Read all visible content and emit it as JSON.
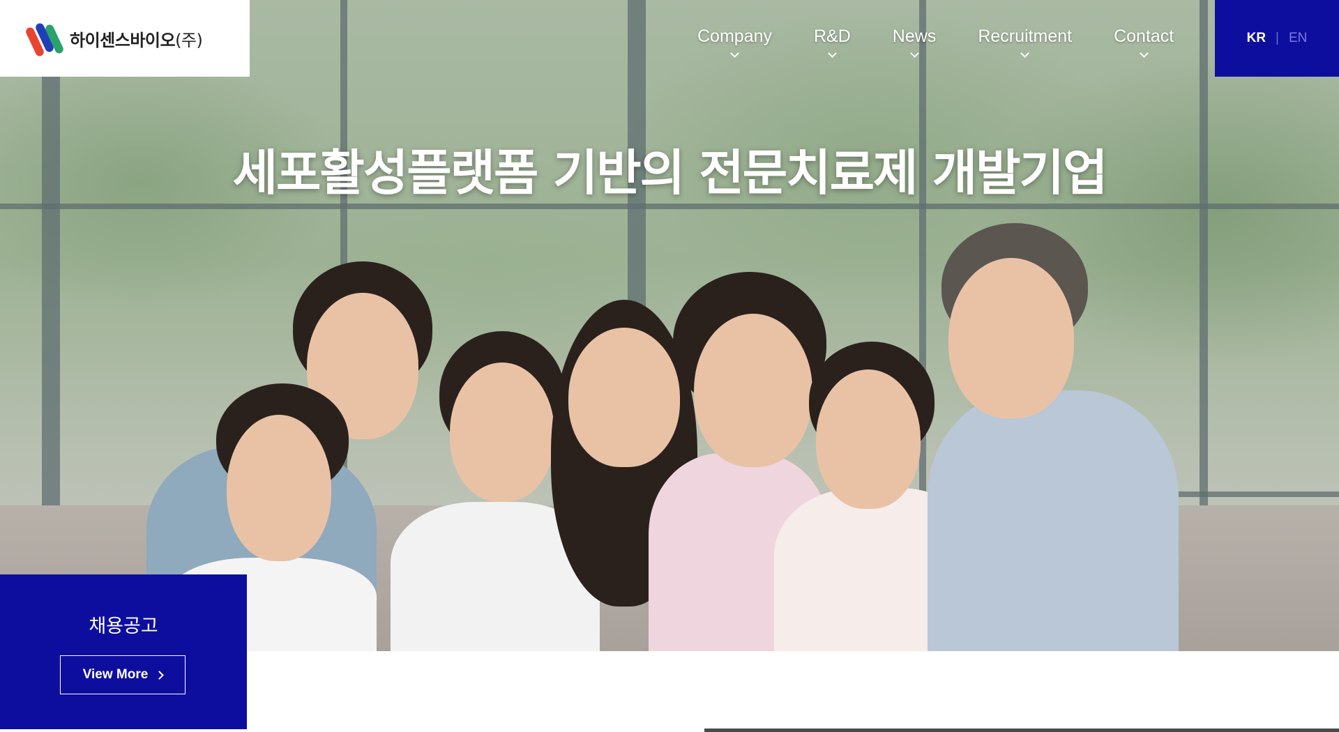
{
  "header": {
    "logo_text": "하이센스바이오",
    "logo_suffix": "(주)",
    "nav": [
      {
        "label": "Company"
      },
      {
        "label": "R&D"
      },
      {
        "label": "News"
      },
      {
        "label": "Recruitment"
      },
      {
        "label": "Contact"
      }
    ],
    "lang": {
      "kr": "KR",
      "separator": "|",
      "en": "EN"
    }
  },
  "hero": {
    "title": "세포활성플랫폼 기반의 전문치료제 개발기업"
  },
  "recruit": {
    "title": "채용공고",
    "button_label": "View More"
  },
  "colors": {
    "brand_blue": "#0e0e9e",
    "logo_red": "#e8452f",
    "logo_blue": "#1f3fb8",
    "logo_green": "#2aa36b"
  }
}
